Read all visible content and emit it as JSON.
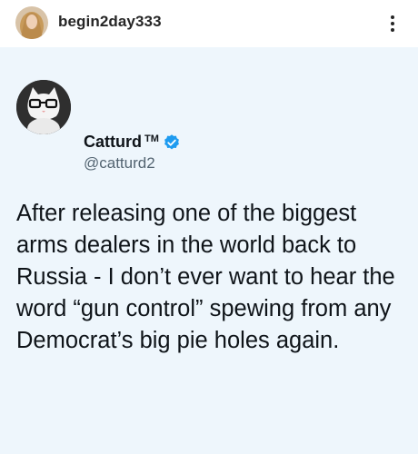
{
  "post": {
    "username": "begin2day333",
    "more_icon": "more-vertical-icon"
  },
  "tweet": {
    "display_name": "Catturd",
    "trademark": "TM",
    "verified_icon": "verified-badge-icon",
    "verified_color": "#1d9bf0",
    "handle": "@catturd2",
    "text": "After releasing one of the biggest arms dealers in the world back to Russia - I don’t ever want to hear the word “gun control” spewing from any Democrat’s big pie holes again."
  },
  "colors": {
    "media_background": "#eef6fc",
    "header_background": "#ffffff",
    "text_primary": "#0f1419",
    "text_secondary": "#536471"
  }
}
